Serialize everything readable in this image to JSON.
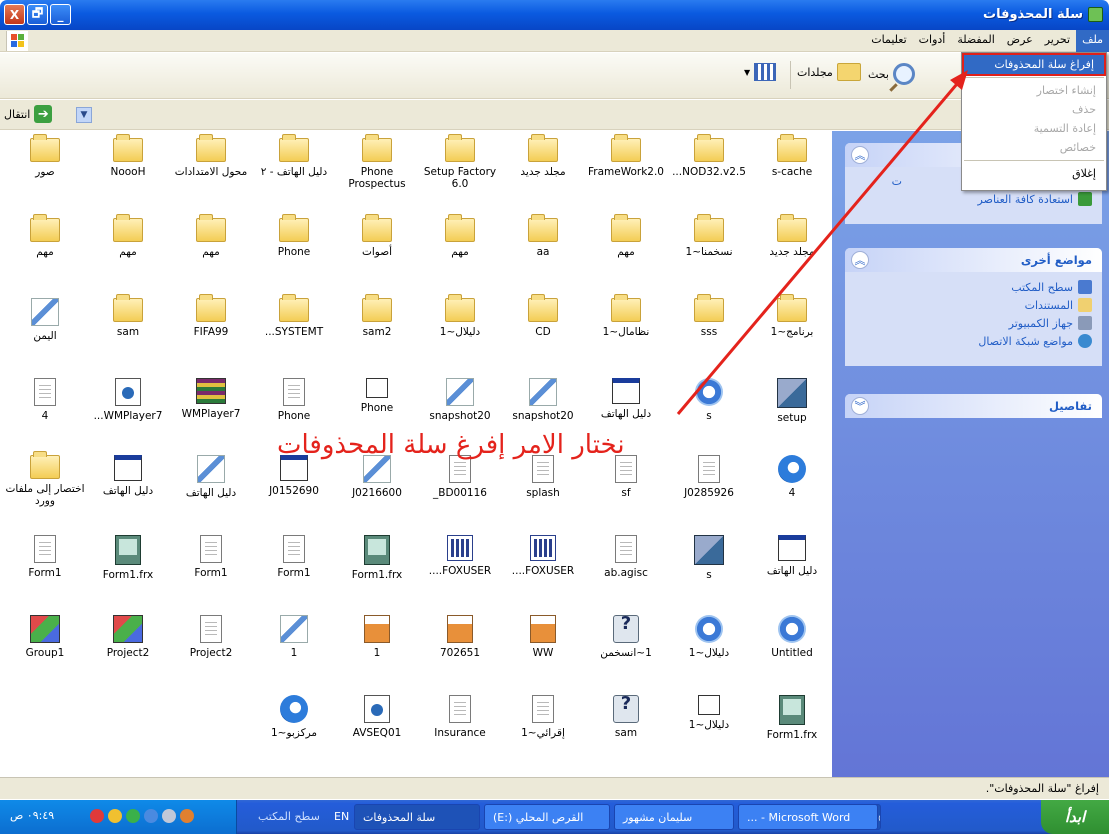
{
  "window": {
    "title": "سلة المحذوفات",
    "buttons": {
      "close": "X",
      "maximize": "🗗",
      "minimize": "_"
    }
  },
  "menubar": {
    "items": [
      "ملف",
      "تحرير",
      "عرض",
      "المفضلة",
      "أدوات",
      "تعليمات"
    ]
  },
  "toolbar": {
    "search_label": "بحث",
    "folders_label": "مجلدات"
  },
  "addressbar": {
    "go_label": "انتقال"
  },
  "file_menu": {
    "items": [
      {
        "label": "إفراغ سلة المحذوفات",
        "state": "selected"
      },
      {
        "label": "إنشاء اختصار",
        "state": "disabled"
      },
      {
        "label": "حذف",
        "state": "disabled"
      },
      {
        "label": "إعادة التسمية",
        "state": "disabled"
      },
      {
        "label": "خصائص",
        "state": "disabled"
      },
      {
        "label": "إغلاق",
        "state": "normal"
      }
    ]
  },
  "sidepanel": {
    "tasks": {
      "partial_text": "ت",
      "restore_label": "استعادة كافة العناصر"
    },
    "other_places": {
      "title": "مواضع أخرى",
      "links": [
        "سطح المكتب",
        "المستندات",
        "جهاز الكمبيوتر",
        "مواضع شبكة الاتصال"
      ]
    },
    "details": {
      "title": "تفاصيل"
    }
  },
  "files": {
    "row1": [
      "s-cache",
      "NOD32.v2.5...",
      "FrameWork2.0",
      "مجلد جديد",
      "Setup Factory 6.0",
      "Phone Prospectus",
      "دليل الهاتف - ٢",
      "محول الامتدادات",
      "NoooH",
      "صور"
    ],
    "row2": [
      "مجلد جديد",
      "نسخمنا~1",
      "مهم",
      "aa",
      "مهم",
      "أصوات",
      "Phone",
      "مهم",
      "مهم",
      "مهم"
    ],
    "row3": [
      "برنامج~1",
      "sss",
      "نظامال~1",
      "CD",
      "دليلال~1",
      "sam2",
      "SYSTEMT...",
      "FIFA99",
      "sam",
      "اليمن"
    ],
    "row4": [
      "setup",
      "s",
      "دليل الهاتف",
      "snapshot20",
      "snapshot20",
      "Phone",
      "Phone",
      "WMPlayer7",
      "WMPlayer7...",
      "4"
    ],
    "row5": [
      "4",
      "J0285926",
      "sf",
      "splash",
      "BD00116_",
      "J0216600",
      "J0152690",
      "دليل الهاتف",
      "دليل الهاتف",
      "اختصار إلى ملفات وورد"
    ],
    "row6": [
      "دليل الهاتف",
      "s",
      "ab.agisc",
      "FOXUSER....",
      "FOXUSER....",
      "Form1.frx",
      "Form1",
      "Form1",
      "Form1.frx",
      "Form1"
    ],
    "row7": [
      "Untitled",
      "دليلال~1",
      "1~انسخمن",
      "WW",
      "702651",
      "1",
      "1",
      "Project2",
      "Project2",
      "Group1"
    ],
    "row8": [
      "Form1.frx",
      "دليلال~1",
      "sam",
      "إقرائي~1",
      "Insurance",
      "AVSEQ01",
      "مركزبو~1"
    ]
  },
  "annotation": {
    "text": "نختار الامر إفرغ سلة المحذوفات",
    "color": "#e4231c"
  },
  "statusbar": {
    "text": "إفراغ \"سلة المحذوفات\"."
  },
  "taskbar": {
    "start_label": "ابدأ",
    "tasks": [
      "Microsoft Word - ...",
      "سليمان مشهور",
      "القرص المحلي (:E)",
      "سلة المحذوفات"
    ],
    "desktop_label": "سطح المكتب",
    "lang": "EN",
    "clock": "٠٩:٤٩ ص"
  }
}
